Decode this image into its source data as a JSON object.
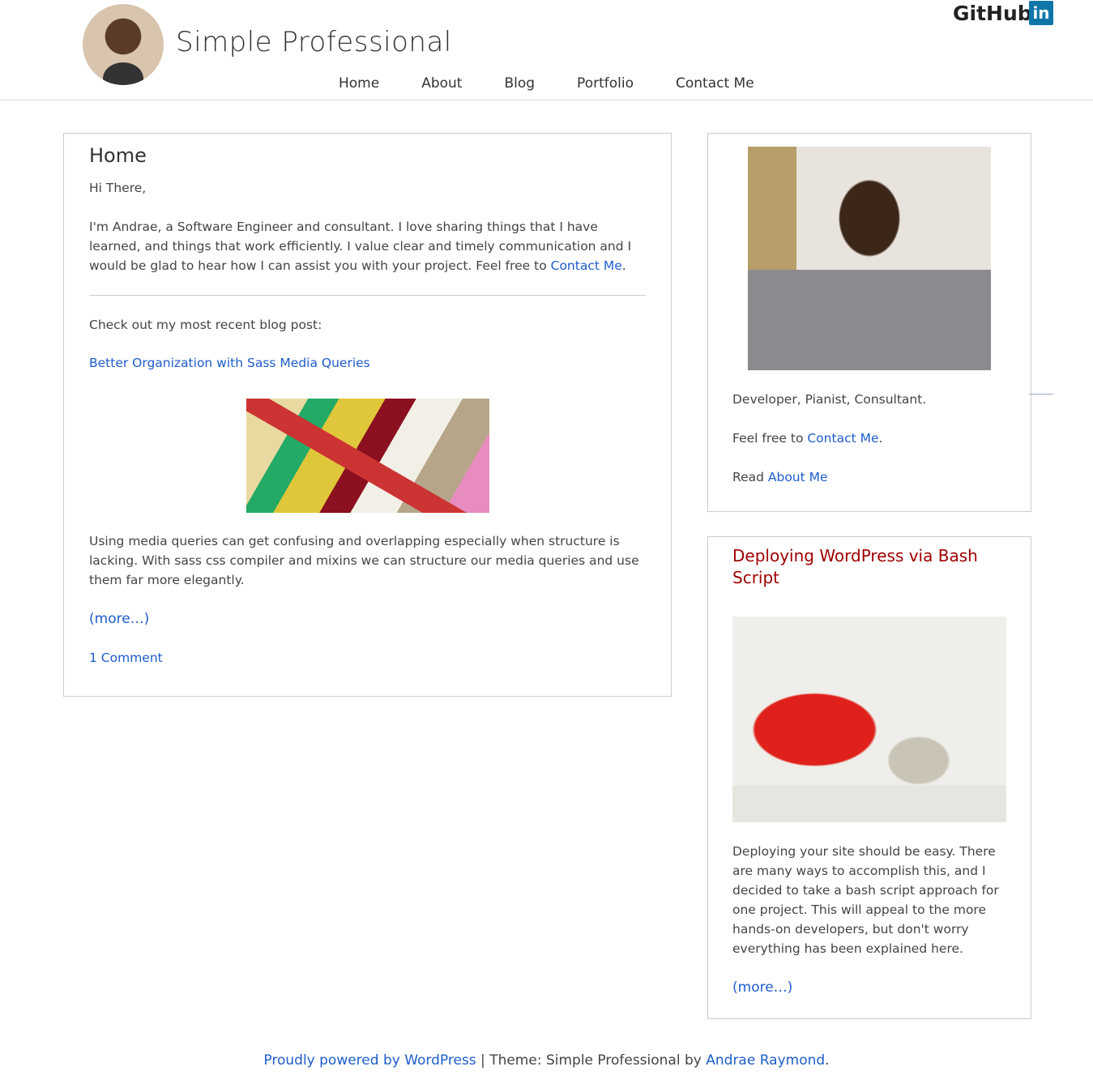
{
  "header": {
    "site_title": "Simple Professional",
    "nav": [
      "Home",
      "About",
      "Blog",
      "Portfolio",
      "Contact Me"
    ],
    "github": "GitHub",
    "linkedin": "in"
  },
  "main": {
    "title": "Home",
    "greeting": "Hi There,",
    "intro": "I'm Andrae, a Software Engineer and consultant. I love sharing things that I have learned, and things that work efficiently. I value clear and timely communication and I would be glad to hear how I can assist you with your project. Feel free to ",
    "intro_link": "Contact Me",
    "intro_end": ".",
    "recent_label": "Check out my most recent blog post:",
    "post_title": "Better Organization with Sass Media Queries",
    "post_excerpt": "Using media queries can get confusing and overlapping especially when structure is lacking. With sass css compiler and mixins we can structure our media queries and use them far more elegantly.",
    "more": "(more…)",
    "comments": "1 Comment"
  },
  "sidebar": {
    "tagline": "Developer, Pianist, Consultant.",
    "contact_pre": "Feel free to ",
    "contact_link": "Contact Me",
    "contact_end": ".",
    "read_pre": "Read ",
    "read_link": "About Me",
    "post_title": "Deploying WordPress via Bash Script",
    "post_excerpt": "Deploying your site should be easy. There are many ways to accomplish this, and I decided to take a bash script approach for one project. This will appeal to the more hands-on developers, but don't worry everything has been explained here.",
    "more": "(more…)"
  },
  "footer": {
    "powered": "Proudly powered by WordPress",
    "sep": " | Theme: Simple Professional by ",
    "author": "Andrae Raymond",
    "end": "."
  }
}
